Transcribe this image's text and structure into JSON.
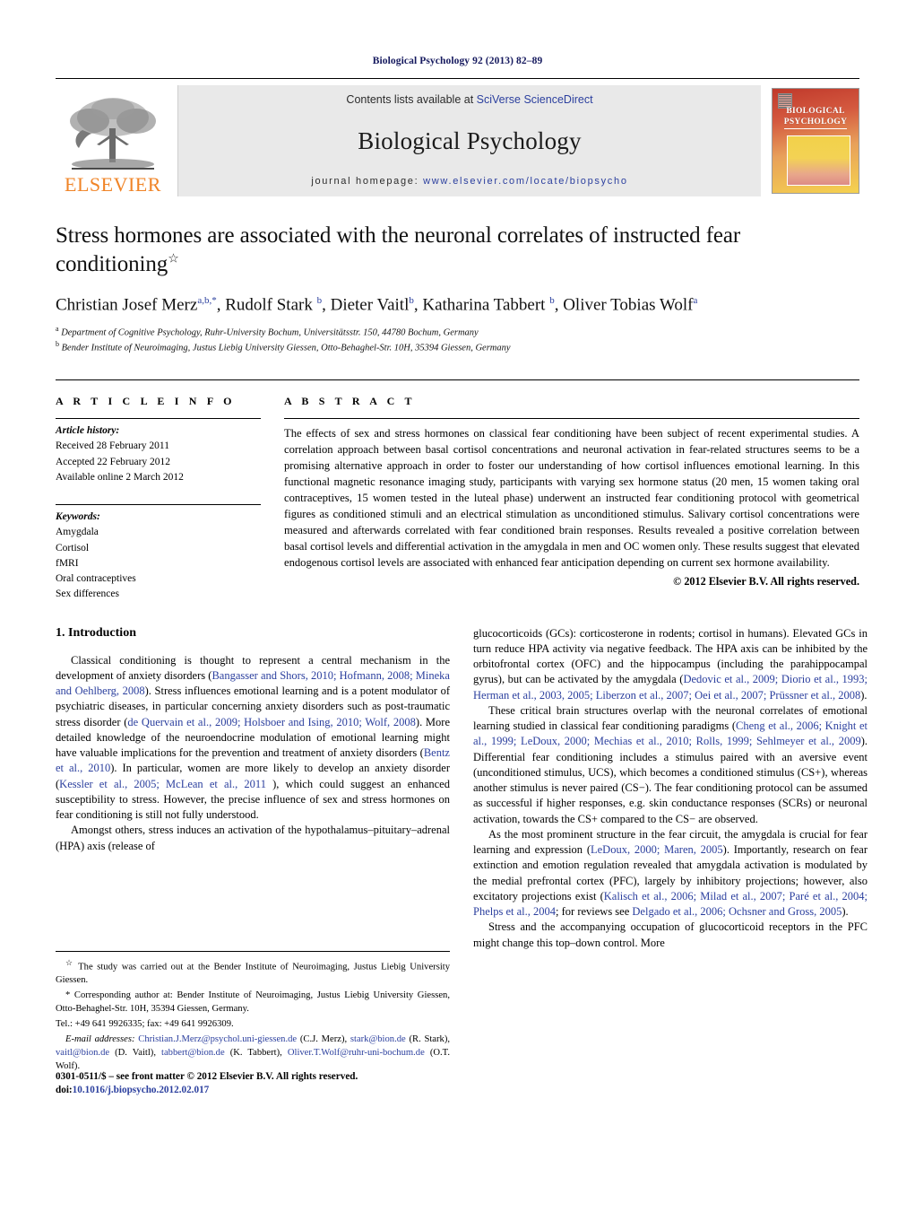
{
  "running_head": "Biological Psychology 92 (2013) 82–89",
  "masthead": {
    "publisher_wordmark": "ELSEVIER",
    "contents_prefix": "Contents lists available at ",
    "contents_link": "SciVerse ScienceDirect",
    "journal_title": "Biological Psychology",
    "homepage_prefix": "journal homepage: ",
    "homepage_link": "www.elsevier.com/locate/biopsycho",
    "cover_title_line1": "BIOLOGICAL",
    "cover_title_line2": "PSYCHOLOGY"
  },
  "article": {
    "title": "Stress hormones are associated with the neuronal correlates of instructed fear conditioning",
    "title_mark": "☆",
    "authors_html": "Christian Josef Merz<sup>a,b,</sup><sup>*</sup>, Rudolf Stark <sup>b</sup>, Dieter Vaitl<sup>b</sup>, Katharina Tabbert <sup>b</sup>, Oliver Tobias Wolf<sup>a</sup>",
    "affiliation_a": "Department of Cognitive Psychology, Ruhr-University Bochum, Universitätsstr. 150, 44780 Bochum, Germany",
    "affiliation_b": "Bender Institute of Neuroimaging, Justus Liebig University Giessen, Otto-Behaghel-Str. 10H, 35394 Giessen, Germany"
  },
  "info": {
    "label": "A R T I C L E  I N F O",
    "history_label": "Article history:",
    "received": "Received 28 February 2011",
    "accepted": "Accepted 22 February 2012",
    "available": "Available online 2 March 2012",
    "keywords_label": "Keywords:",
    "keywords": [
      "Amygdala",
      "Cortisol",
      "fMRI",
      "Oral contraceptives",
      "Sex differences"
    ]
  },
  "abstract": {
    "label": "A B S T R A C T",
    "text": "The effects of sex and stress hormones on classical fear conditioning have been subject of recent experimental studies. A correlation approach between basal cortisol concentrations and neuronal activation in fear-related structures seems to be a promising alternative approach in order to foster our understanding of how cortisol influences emotional learning. In this functional magnetic resonance imaging study, participants with varying sex hormone status (20 men, 15 women taking oral contraceptives, 15 women tested in the luteal phase) underwent an instructed fear conditioning protocol with geometrical figures as conditioned stimuli and an electrical stimulation as unconditioned stimulus. Salivary cortisol concentrations were measured and afterwards correlated with fear conditioned brain responses. Results revealed a positive correlation between basal cortisol levels and differential activation in the amygdala in men and OC women only. These results suggest that elevated endogenous cortisol levels are associated with enhanced fear anticipation depending on current sex hormone availability.",
    "copyright": "© 2012 Elsevier B.V. All rights reserved."
  },
  "body": {
    "section_number_title": "1. Introduction",
    "left_p1_html": "Classical conditioning is thought to represent a central mechanism in the development of anxiety disorders (<span class=\"cite\">Bangasser and Shors, 2010; Hofmann, 2008; Mineka and Oehlberg, 2008</span>). Stress influences emotional learning and is a potent modulator of psychiatric diseases, in particular concerning anxiety disorders such as post-traumatic stress disorder (<span class=\"cite\">de Quervain et al., 2009; Holsboer and Ising, 2010; Wolf, 2008</span>). More detailed knowledge of the neuroendocrine modulation of emotional learning might have valuable implications for the prevention and treatment of anxiety disorders (<span class=\"cite\">Bentz et al., 2010</span>). In particular, women are more likely to develop an anxiety disorder (<span class=\"cite\">Kessler et al., 2005; McLean et al., 2011</span> ), which could suggest an enhanced susceptibility to stress. However, the precise influence of sex and stress hormones on fear conditioning is still not fully understood.",
    "left_p2_html": "Amongst others, stress induces an activation of the hypothalamus–pituitary–adrenal (HPA) axis (release of",
    "right_p1_html": "glucocorticoids (GCs): corticosterone in rodents; cortisol in humans). Elevated GCs in turn reduce HPA activity via negative feedback. The HPA axis can be inhibited by the orbitofrontal cortex (OFC) and the hippocampus (including the parahippocampal gyrus), but can be activated by the amygdala (<span class=\"cite\">Dedovic et al., 2009; Diorio et al., 1993; Herman et al., 2003, 2005; Liberzon et al., 2007; Oei et al., 2007; Prüssner et al., 2008</span>).",
    "right_p2_html": "These critical brain structures overlap with the neuronal correlates of emotional learning studied in classical fear conditioning paradigms (<span class=\"cite\">Cheng et al., 2006; Knight et al., 1999; LeDoux, 2000; Mechias et al., 2010; Rolls, 1999; Sehlmeyer et al., 2009</span>). Differential fear conditioning includes a stimulus paired with an aversive event (unconditioned stimulus, UCS), which becomes a conditioned stimulus (CS+), whereas another stimulus is never paired (CS−). The fear conditioning protocol can be assumed as successful if higher responses, e.g. skin conductance responses (SCRs) or neuronal activation, towards the CS+ compared to the CS− are observed.",
    "right_p3_html": "As the most prominent structure in the fear circuit, the amygdala is crucial for fear learning and expression (<span class=\"cite\">LeDoux, 2000; Maren, 2005</span>). Importantly, research on fear extinction and emotion regulation revealed that amygdala activation is modulated by the medial prefrontal cortex (PFC), largely by inhibitory projections; however, also excitatory projections exist (<span class=\"cite\">Kalisch et al., 2006; Milad et al., 2007; Paré et al., 2004; Phelps et al., 2004</span>; for reviews see <span class=\"cite\">Delgado et al., 2006; Ochsner and Gross, 2005</span>).",
    "right_p4_html": "Stress and the accompanying occupation of glucocorticoid receptors in the PFC might change this top–down control. More"
  },
  "footnotes": {
    "study_note_html": "<sup>☆</sup> The study was carried out at the Bender Institute of Neuroimaging, Justus Liebig University Giessen.",
    "corresponding_html": "* Corresponding author at: Bender Institute of Neuroimaging, Justus Liebig University Giessen, Otto-Behaghel-Str. 10H, 35394 Giessen, Germany.",
    "tel_html": "Tel.: +49 641 9926335; fax: +49 641 9926309.",
    "emails_html": "<span class=\"mail-label\">E-mail addresses:</span> <span class=\"link\">Christian.J.Merz@psychol.uni-giessen.de</span> (C.J. Merz), <span class=\"link\">stark@bion.de</span> (R. Stark), <span class=\"link\">vaitl@bion.de</span> (D. Vaitl), <span class=\"link\">tabbert@bion.de</span> (K. Tabbert), <span class=\"link\">Oliver.T.Wolf@ruhr-uni-bochum.de</span> (O.T. Wolf)."
  },
  "imprint": {
    "line1": "0301-0511/$ – see front matter © 2012 Elsevier B.V. All rights reserved.",
    "doi_prefix": "doi:",
    "doi": "10.1016/j.biopsycho.2012.02.017"
  }
}
